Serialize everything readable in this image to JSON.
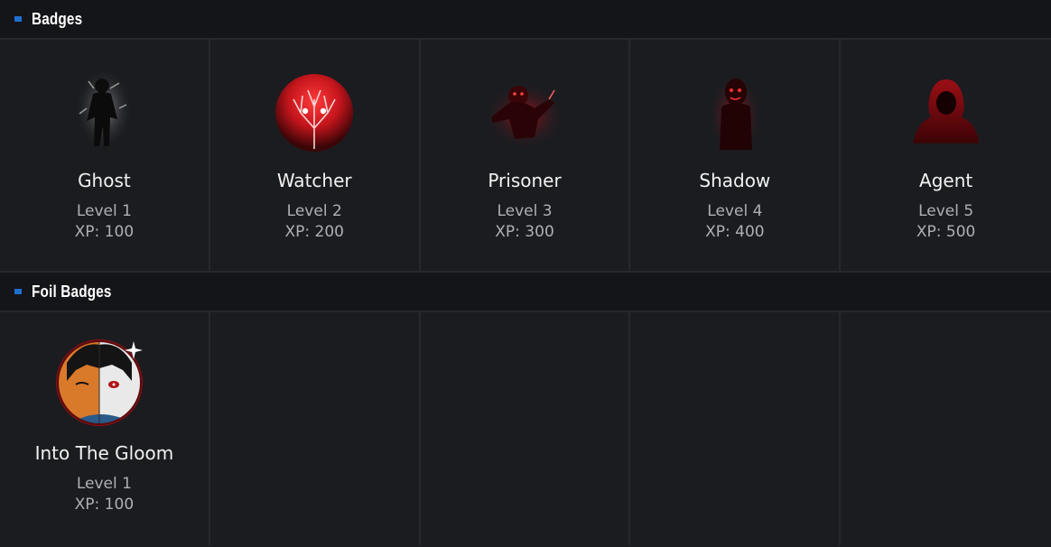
{
  "sections": {
    "badges": {
      "title": "Badges",
      "items": [
        {
          "name": "Ghost",
          "level": "Level 1",
          "xp": "XP: 100",
          "icon": "ghost-icon"
        },
        {
          "name": "Watcher",
          "level": "Level 2",
          "xp": "XP: 200",
          "icon": "watcher-icon"
        },
        {
          "name": "Prisoner",
          "level": "Level 3",
          "xp": "XP: 300",
          "icon": "prisoner-icon"
        },
        {
          "name": "Shadow",
          "level": "Level 4",
          "xp": "XP: 400",
          "icon": "shadow-icon"
        },
        {
          "name": "Agent",
          "level": "Level 5",
          "xp": "XP: 500",
          "icon": "agent-icon"
        }
      ]
    },
    "foil_badges": {
      "title": "Foil Badges",
      "items": [
        {
          "name": "Into The Gloom",
          "level": "Level 1",
          "xp": "XP: 100",
          "icon": "into-the-gloom-icon"
        }
      ]
    }
  },
  "colors": {
    "accent": "#1f6fd1",
    "background": "#1b1c20",
    "header_background": "#141518",
    "badge_red": "#c4151c"
  }
}
